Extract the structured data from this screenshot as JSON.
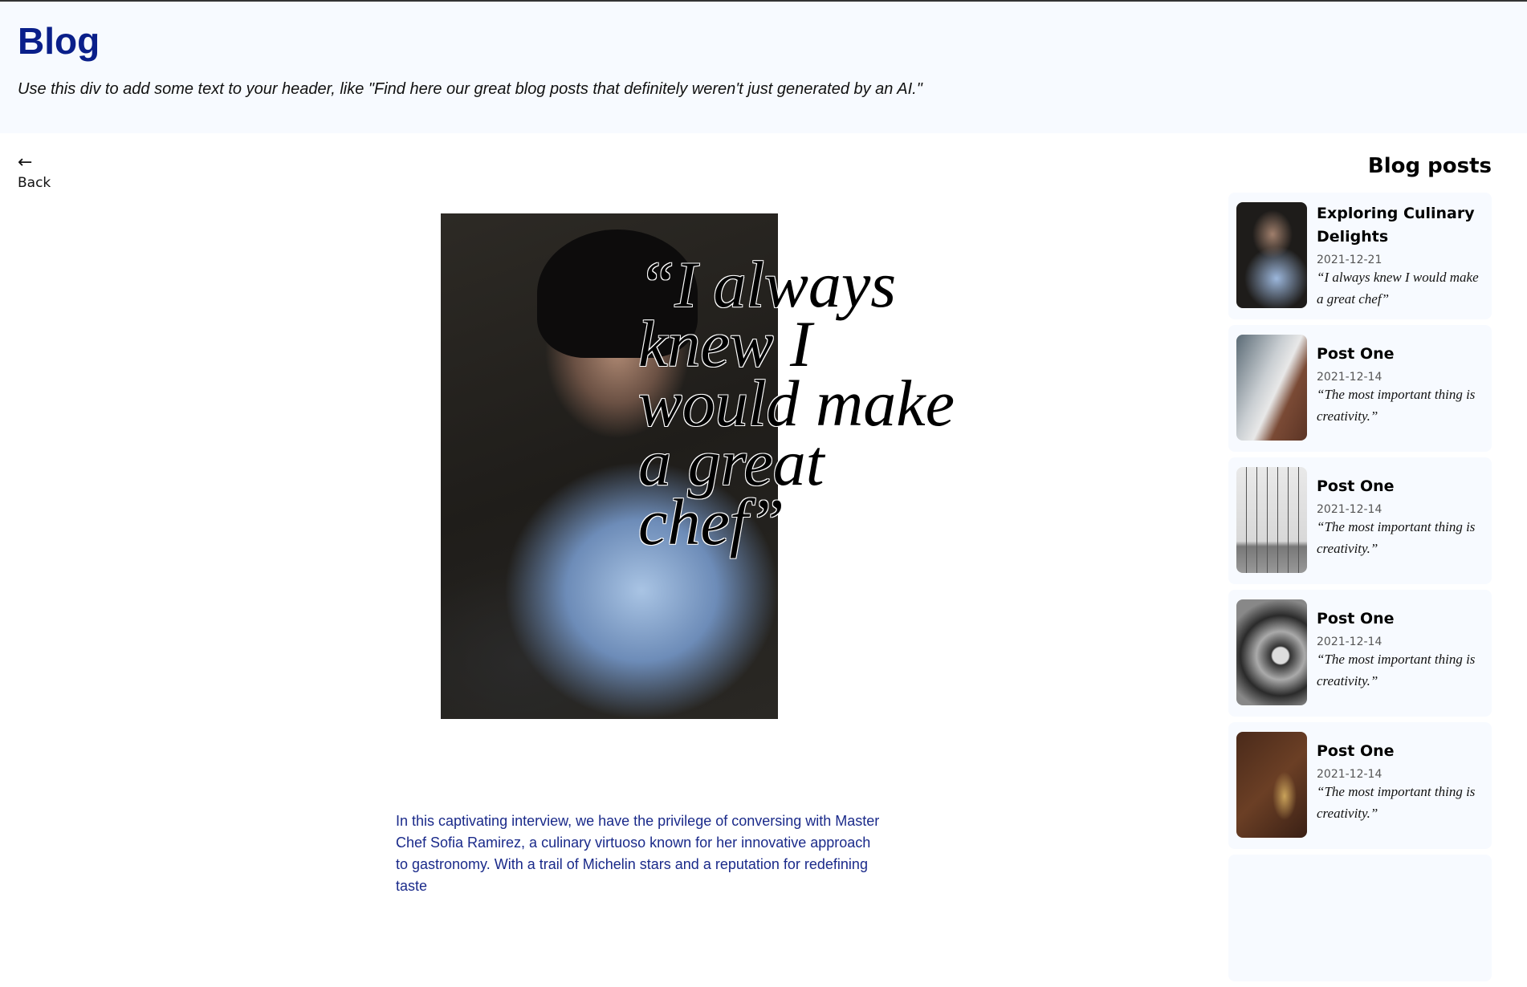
{
  "header": {
    "title": "Blog",
    "subtitle": "Use this div to add some text to your header, like \"Find here our great blog posts that definitely weren't just generated by an AI.\""
  },
  "back": {
    "icon": "arrow-left-icon",
    "label": "Back"
  },
  "article": {
    "quote": "“I always knew I would make a great chef”",
    "body": "In this captivating interview, we have the privilege of conversing with Master Chef Sofia Ramirez, a culinary virtuoso known for her innovative approach to gastronomy. With a trail of Michelin stars and a reputation for redefining taste"
  },
  "sidebar": {
    "heading": "Blog posts",
    "posts": [
      {
        "title": "Exploring Culinary Delights",
        "date": "2021-12-21",
        "quote": "“I always knew I would make a great chef”"
      },
      {
        "title": "Post One",
        "date": "2021-12-14",
        "quote": "“The most important thing is creativity.”"
      },
      {
        "title": "Post One",
        "date": "2021-12-14",
        "quote": "“The most important thing is creativity.”"
      },
      {
        "title": "Post One",
        "date": "2021-12-14",
        "quote": "“The most important thing is creativity.”"
      },
      {
        "title": "Post One",
        "date": "2021-12-14",
        "quote": "“The most important thing is creativity.”"
      }
    ]
  },
  "colors": {
    "title": "#0a1f8a",
    "header_bg": "#f7faff",
    "body_text": "#1a2a8a"
  }
}
